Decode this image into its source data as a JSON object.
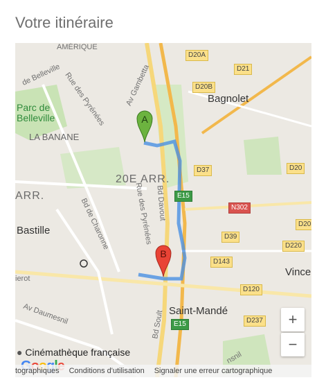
{
  "header": {
    "title": "Votre itinéraire"
  },
  "map": {
    "labels": {
      "amerique": "AMÉRIQUE",
      "belleville_street": "de Belleville",
      "pyrenees_top": "Rue des Pyrénées",
      "gambetta": "Av Gambetta",
      "parc_belleville": "Parc de Belleville",
      "la_banane": "LA BANANE",
      "arr20": "20E ARR.",
      "arr": "ARR.",
      "bastille": "Bastille",
      "charonne": "Bd de Charonne",
      "pyrenees_bottom": "Rue des Pyrénées",
      "davout": "Bd Davout",
      "bagnolet": "Bagnolet",
      "vincennes": "Vince",
      "saint_mande": "Saint-Mandé",
      "soult": "Bd Soult",
      "daumesnil": "Av Daumesnil",
      "ierot": "ierot",
      "daumesnil_right": "nsnil",
      "cinematheque": "Cinémathèque française"
    },
    "shields": {
      "d20a": "D20A",
      "d21": "D21",
      "d20b": "D20B",
      "d37": "D37",
      "d20": "D20",
      "e15a": "E15",
      "n302": "N302",
      "d20c": "D20",
      "d39": "D39",
      "d220": "D220",
      "d143": "D143",
      "d120": "D120",
      "d237": "D237",
      "e15b": "E15"
    },
    "markers": {
      "start": "A",
      "end": "B"
    },
    "zoom": {
      "in": "+",
      "out": "−"
    },
    "footer": {
      "data": "tographiques",
      "terms": "Conditions d'utilisation",
      "report": "Signaler une erreur cartographique"
    },
    "logo": "Google",
    "route_color": "#4a90e2",
    "marker_start_color": "#6cb33f",
    "marker_end_color": "#e94335"
  }
}
